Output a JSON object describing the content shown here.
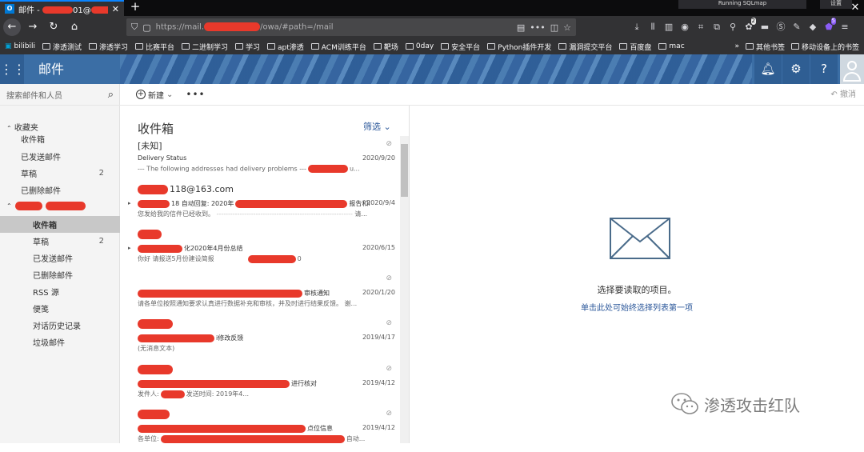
{
  "browser": {
    "tab_title": "邮件 - ",
    "tab_title_suffix": "01@",
    "new_tab": "+",
    "notification": "Running SQLmap",
    "notification2": "设置",
    "url_prefix": "https://mail.",
    "url_suffix": "/owa/#path=/mail",
    "badge_count": "2",
    "badge_count2": "5"
  },
  "bookmarks": [
    "bilibili",
    "渗透测试",
    "渗透学习",
    "比赛平台",
    "二进制学习",
    "学习",
    "apt渗透",
    "ACM训练平台",
    "靶场",
    "0day",
    "安全平台",
    "Python插件开发",
    "漏洞提交平台",
    "百度盘",
    "mac"
  ],
  "bookmarks_right": [
    "其他书签",
    "移动设备上的书签"
  ],
  "owa": {
    "app_title": "邮件",
    "search_placeholder": "搜索邮件和人员",
    "new_label": "新建",
    "undo_label": "撤消",
    "favorites_label": "收藏夹",
    "favorites": [
      {
        "label": "收件箱",
        "count": ""
      },
      {
        "label": "已发送邮件",
        "count": ""
      },
      {
        "label": "草稿",
        "count": "2"
      },
      {
        "label": "已删除邮件",
        "count": ""
      }
    ],
    "account_folders": [
      {
        "label": "收件箱",
        "count": ""
      },
      {
        "label": "草稿",
        "count": "2"
      },
      {
        "label": "已发送邮件",
        "count": ""
      },
      {
        "label": "已删除邮件",
        "count": ""
      },
      {
        "label": "RSS 源",
        "count": ""
      },
      {
        "label": "便笺",
        "count": ""
      },
      {
        "label": "对话历史记录",
        "count": ""
      },
      {
        "label": "垃圾邮件",
        "count": ""
      }
    ],
    "list_title": "收件箱",
    "filter_label": "筛选",
    "messages": [
      {
        "from": "[未知]",
        "subject": "Delivery Status",
        "preview": "--- The following addresses had delivery problems ---",
        "preview_end": "u...",
        "date": "2020/9/20"
      },
      {
        "from": "118@163.com",
        "subject": "18 自动回复: 2020年",
        "subject_end": "报告和i",
        "preview": "您发给我的信件已经收到。",
        "preview_end": "请...",
        "date": "2020/9/4"
      },
      {
        "from": "",
        "subject": "化2020年4月份总结",
        "preview": "你好 请报送5月份建设简报",
        "preview_end": "0",
        "date": "2020/6/15"
      },
      {
        "from": "",
        "subject": "审核通知",
        "preview": "请各单位按照通知要求认真进行数据补充和审核，并及时进行结果反馈。 谢...",
        "date": "2020/1/20"
      },
      {
        "from": "",
        "subject": "i修改反馈",
        "preview": "(无消息文本)",
        "date": "2019/4/17"
      },
      {
        "from": "",
        "subject": "进行核对",
        "preview": "发件人:",
        "preview_end": "发送时间: 2019年4...",
        "date": "2019/4/12"
      },
      {
        "from": "",
        "subject": "点位信息",
        "preview": "各单位:",
        "preview_end": "自动...",
        "date": "2019/4/12"
      }
    ],
    "reading_main": "选择要读取的项目。",
    "reading_link": "单击此处可始终选择列表第一项"
  },
  "watermark": "渗透攻击红队"
}
